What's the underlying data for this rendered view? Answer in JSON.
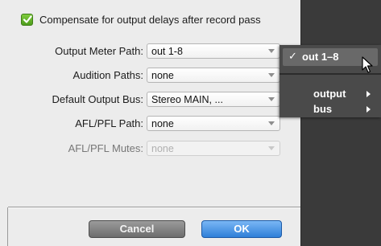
{
  "dialog": {
    "compensate_checkbox": {
      "label": "Compensate for output delays after record pass",
      "checked": true
    },
    "fields": [
      {
        "label": "Output Meter Path:",
        "value": "out 1-8",
        "enabled": true
      },
      {
        "label": "Audition Paths:",
        "value": "none",
        "enabled": true
      },
      {
        "label": "Default Output Bus:",
        "value": "Stereo MAIN, ...",
        "enabled": true
      },
      {
        "label": "AFL/PFL Path:",
        "value": "none",
        "enabled": true
      },
      {
        "label": "AFL/PFL Mutes:",
        "value": "none",
        "enabled": false
      }
    ],
    "buttons": {
      "cancel": "Cancel",
      "ok": "OK"
    }
  },
  "menu": {
    "selected_check": "✓",
    "selected_item": "out 1–8",
    "submenus": [
      "output",
      "bus"
    ]
  },
  "colors": {
    "checkbox_green": "#5fb02a",
    "ok_blue": "#2f7fd8",
    "menu_bg": "#4a4a4a"
  }
}
